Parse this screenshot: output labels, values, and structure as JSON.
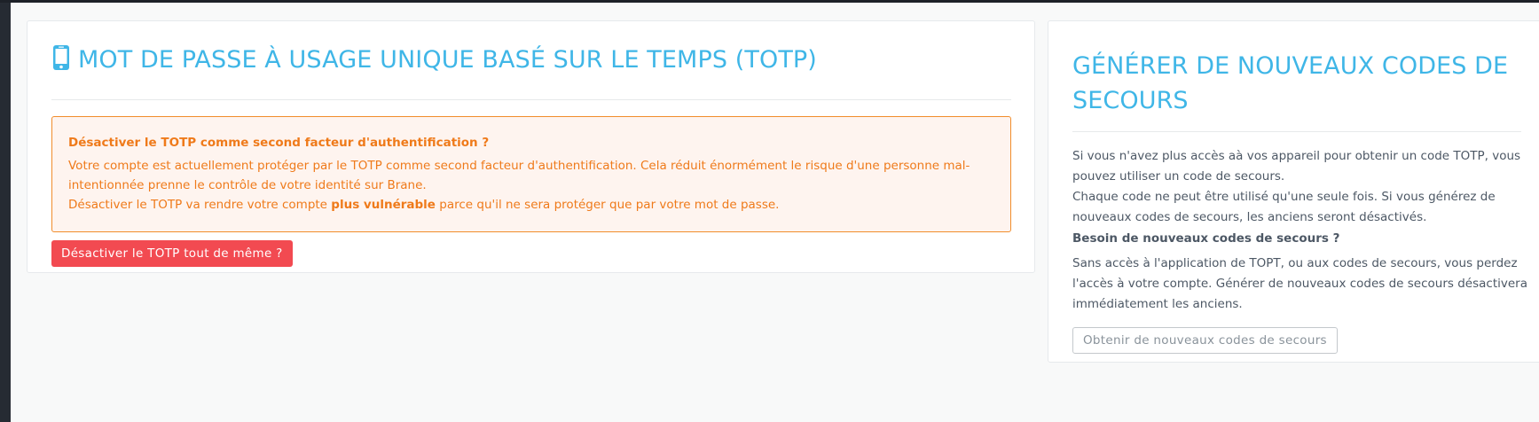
{
  "totp": {
    "title": "MOT DE PASSE À USAGE UNIQUE BASÉ SUR LE TEMPS (TOTP)",
    "icon": "mobile-phone-icon",
    "alert": {
      "title": "Désactiver le TOTP comme second facteur d'authentification ?",
      "line1": "Votre compte est actuellement protéger par le TOTP comme second facteur d'authentification. Cela réduit énormément le risque d'une personne mal-intentionnée prenne le contrôle de votre identité sur Brane.",
      "line2_prefix": "Désactiver le TOTP va rendre votre compte ",
      "line2_strong": "plus vulnérable",
      "line2_suffix": " parce qu'il ne sera protéger que par votre mot de passe."
    },
    "disable_button": "Désactiver le TOTP tout de même ?"
  },
  "recovery": {
    "title": "GÉNÉRER DE NOUVEAUX CODES DE SECOURS",
    "para1": "Si vous n'avez plus accès aà vos appareil pour obtenir un code TOTP, vous pouvez utiliser un code de secours.",
    "para2": "Chaque code ne peut être utilisé qu'une seule fois. Si vous générez de nouveaux codes de secours, les anciens seront désactivés.",
    "subheading": "Besoin de nouveaux codes de secours ?",
    "para3": "Sans accès à l'application de TOPT, ou aux codes de secours, vous perdez l'accès à votre compte. Générer de nouveaux codes de secours désactivera immédiatement les anciens.",
    "button": "Obtenir de nouveaux codes de secours"
  },
  "colors": {
    "accent": "#3fb6e7",
    "warning": "#ef7a1a",
    "danger": "#f24a51"
  }
}
